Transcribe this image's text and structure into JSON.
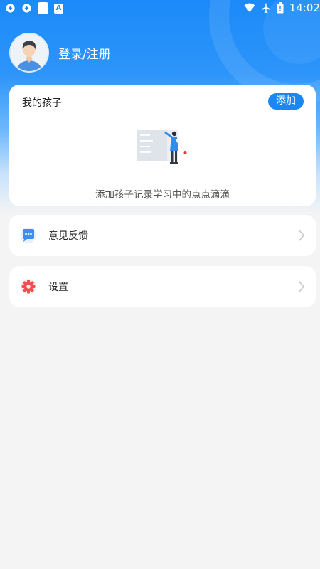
{
  "status_bar": {
    "time": "14:02",
    "left_icons": [
      "sync-icon",
      "sync-icon",
      "app-square-icon",
      "font-a-icon"
    ],
    "right_icons": [
      "wifi-icon",
      "airplane-icon",
      "battery-icon"
    ],
    "app_letter": "A"
  },
  "profile": {
    "login_label": "登录/注册"
  },
  "children_card": {
    "title": "我的孩子",
    "add_label": "添加",
    "empty_text": "添加孩子记录学习中的点点滴滴"
  },
  "menu": {
    "feedback_label": "意见反馈",
    "settings_label": "设置"
  },
  "colors": {
    "primary_blue": "#1b87f2",
    "background": "#f4f4f4",
    "settings_icon_red": "#ee4f4f",
    "feedback_icon_blue": "#3e8ef7"
  }
}
